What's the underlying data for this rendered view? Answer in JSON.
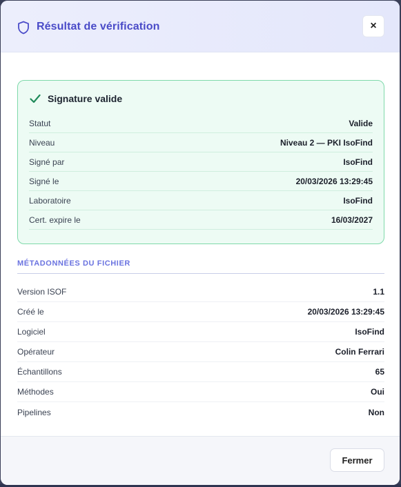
{
  "dialog": {
    "title": "Résultat de vérification",
    "close_label": "×"
  },
  "signature": {
    "title": "Signature valide",
    "rows": [
      {
        "label": "Statut",
        "value": "Valide"
      },
      {
        "label": "Niveau",
        "value": "Niveau 2 — PKI IsoFind"
      },
      {
        "label": "Signé par",
        "value": "IsoFind"
      },
      {
        "label": "Signé le",
        "value": "20/03/2026 13:29:45"
      },
      {
        "label": "Laboratoire",
        "value": "IsoFind"
      },
      {
        "label": "Cert. expire le",
        "value": "16/03/2027"
      }
    ]
  },
  "metadata": {
    "section_title": "MÉTADONNÉES DU FICHIER",
    "rows": [
      {
        "label": "Version ISOF",
        "value": "1.1"
      },
      {
        "label": "Créé le",
        "value": "20/03/2026 13:29:45"
      },
      {
        "label": "Logiciel",
        "value": "IsoFind"
      },
      {
        "label": "Opérateur",
        "value": "Colin Ferrari"
      },
      {
        "label": "Échantillons",
        "value": "65"
      },
      {
        "label": "Méthodes",
        "value": "Oui"
      },
      {
        "label": "Pipelines",
        "value": "Non"
      }
    ]
  },
  "footer": {
    "close_button_label": "Fermer"
  },
  "colors": {
    "accent": "#4a4bc8",
    "success_bg": "#edfbf4",
    "success_border": "#7ed9aa",
    "success_check": "#1f8a5a"
  },
  "icons": {
    "header": "shield-icon",
    "signature": "check-icon",
    "close": "close-icon"
  }
}
